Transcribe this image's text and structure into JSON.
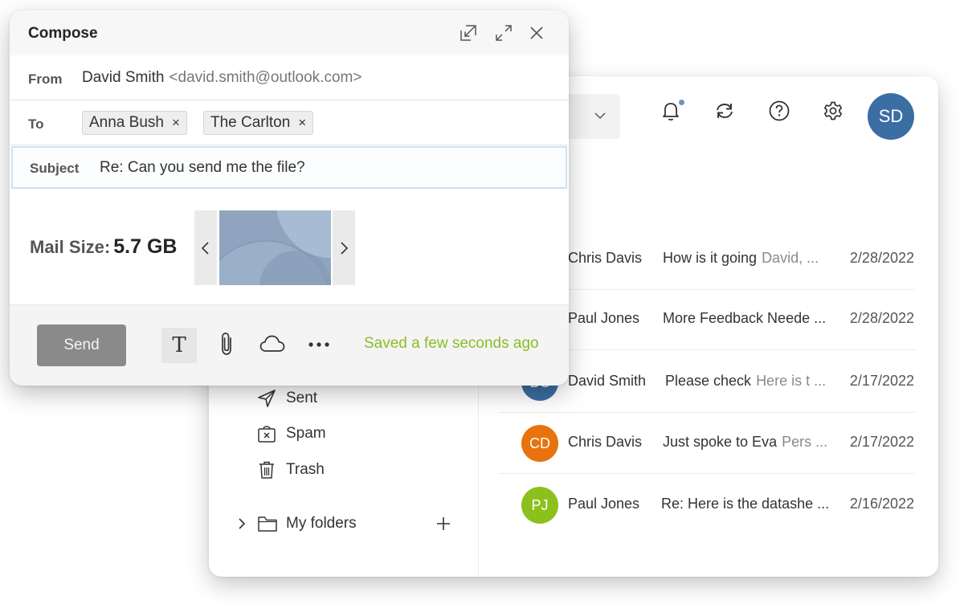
{
  "compose": {
    "title": "Compose",
    "from_label": "From",
    "from_name": "David Smith",
    "from_address": "<david.smith@outlook.com>",
    "to_label": "To",
    "recipients": [
      {
        "name": "Anna Bush",
        "remove": "×"
      },
      {
        "name": "The Carlton",
        "remove": "×"
      }
    ],
    "subject_label": "Subject",
    "subject_value": "Re: Can you send me the file?",
    "mail_size_label": "Mail Size:",
    "mail_size_value": "5.7 GB",
    "send_label": "Send",
    "format_label": "T",
    "saved_status": "Saved a few seconds ago",
    "saved_color": "#8bbd27"
  },
  "header": {
    "avatar_initials": "SD",
    "avatar_color": "#3b6ea3",
    "notification_dot_color": "#6a96c4"
  },
  "folders": [
    {
      "label": "Sent",
      "icon": "send-icon"
    },
    {
      "label": "Spam",
      "icon": "spam-icon"
    },
    {
      "label": "Trash",
      "icon": "trash-icon"
    }
  ],
  "my_folders": {
    "label": "My folders",
    "icon": "folder-icon"
  },
  "emails": [
    {
      "initials": "",
      "sender": "Chris Davis",
      "subject": "How is it going",
      "preview": "David, ...",
      "date": "2/28/2022",
      "color": ""
    },
    {
      "initials": "",
      "sender": "Paul Jones",
      "subject": "More Feedback Neede ...",
      "preview": "",
      "date": "2/28/2022",
      "color": ""
    },
    {
      "initials": "DS",
      "sender": "David Smith",
      "subject": "Please check",
      "preview": "Here is t ...",
      "date": "2/17/2022",
      "color": "#3b6ea3"
    },
    {
      "initials": "CD",
      "sender": "Chris Davis",
      "subject": "Just spoke to Eva",
      "preview": "Pers ...",
      "date": "2/17/2022",
      "color": "#e8720c"
    },
    {
      "initials": "PJ",
      "sender": "Paul Jones",
      "subject": "Re: Here is the datashe ...",
      "preview": "",
      "date": "2/16/2022",
      "color": "#8cc11d"
    }
  ]
}
